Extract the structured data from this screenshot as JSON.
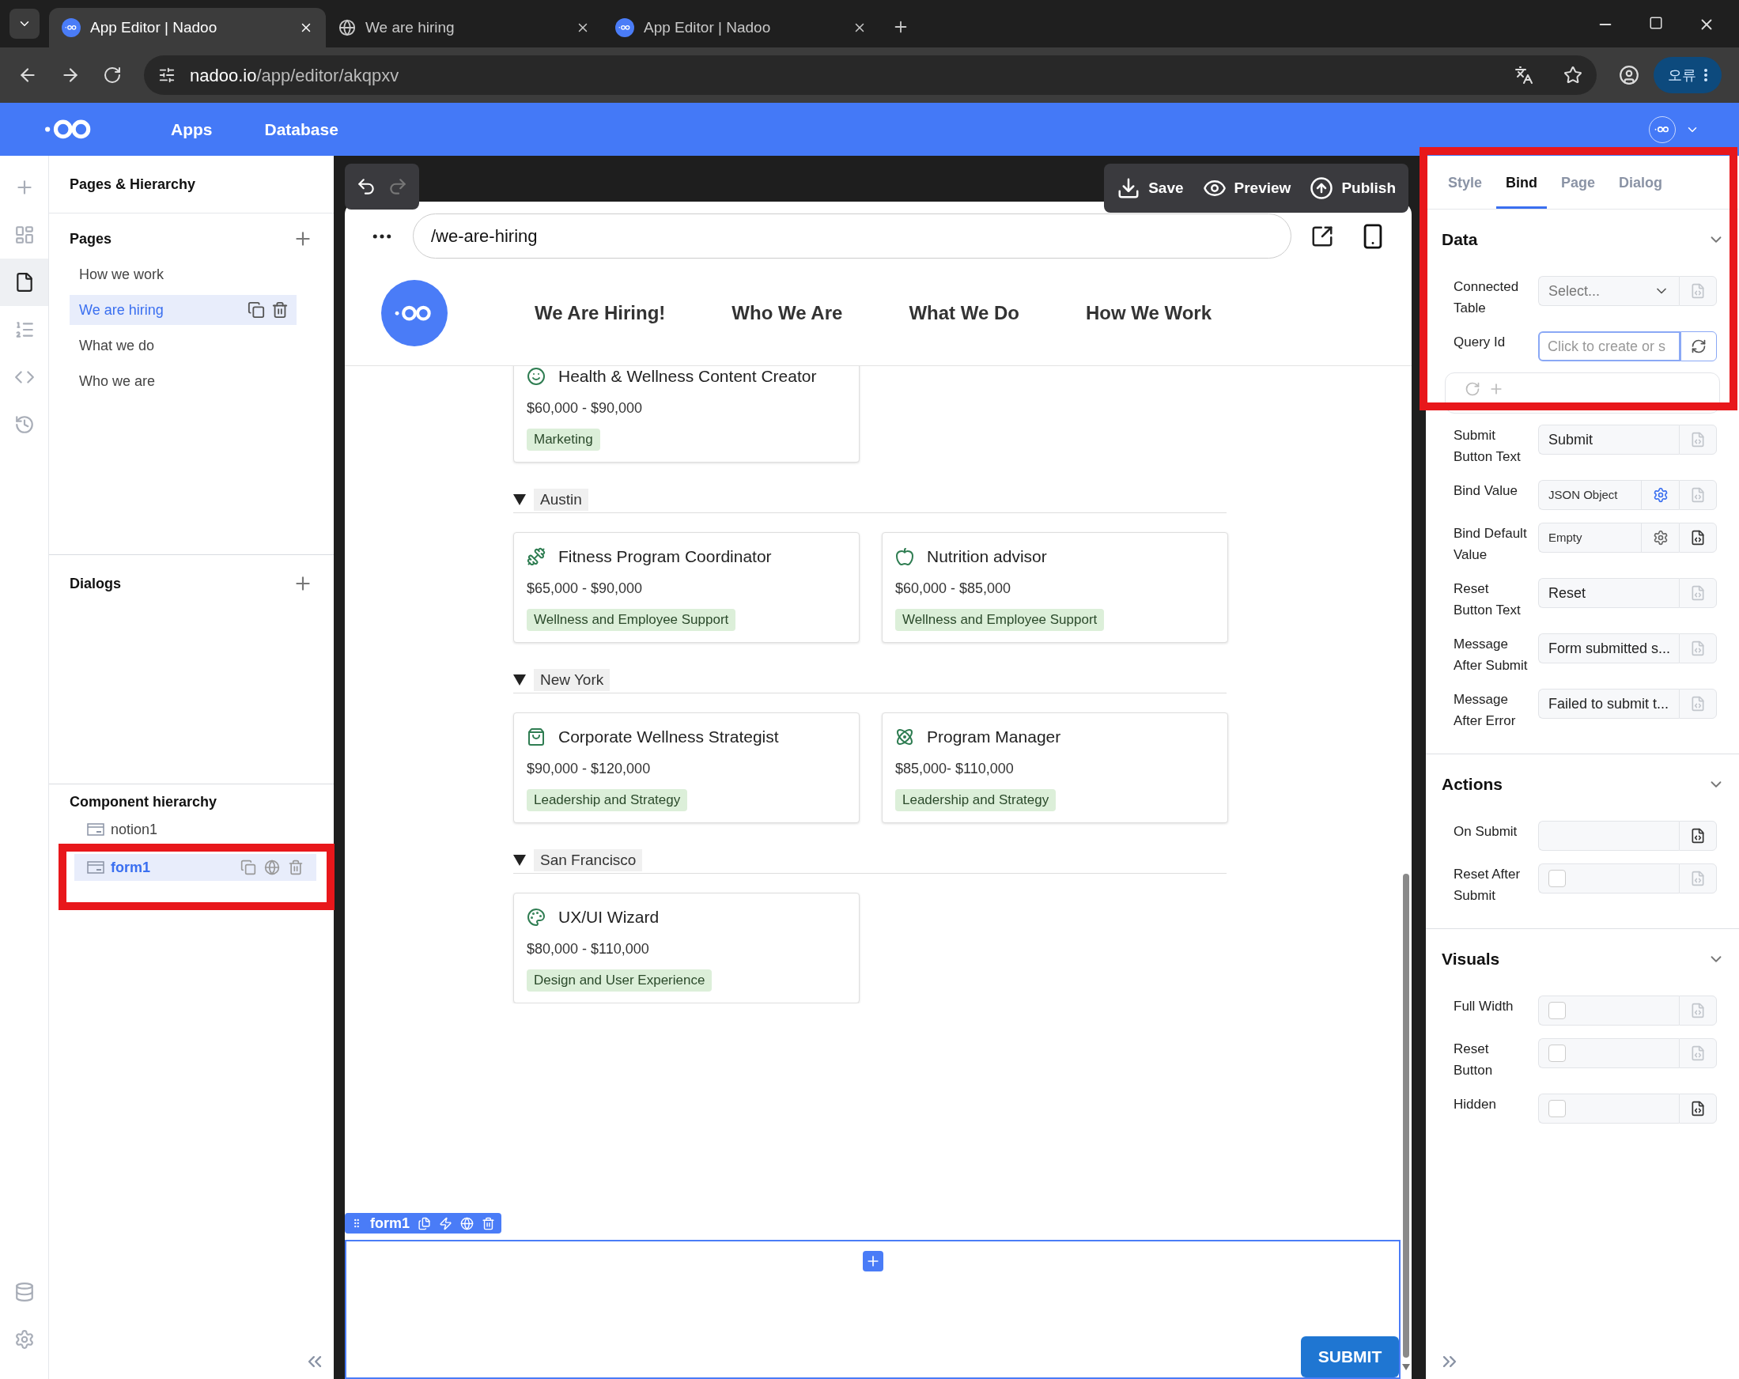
{
  "browser": {
    "tabs": [
      {
        "title": "App Editor | Nadoo",
        "kind": "app",
        "selected": true
      },
      {
        "title": "We are hiring",
        "kind": "web",
        "selected": false
      },
      {
        "title": "App Editor | Nadoo",
        "kind": "app",
        "selected": false
      }
    ],
    "url_host": "nadoo.io",
    "url_path": "/app/editor/akqpxv",
    "profile_label": "오류"
  },
  "app_header": {
    "nav": [
      "Apps",
      "Database"
    ]
  },
  "rail": {
    "items": [
      {
        "kind": "add",
        "selected": false
      },
      {
        "kind": "layout",
        "selected": false
      },
      {
        "kind": "pages",
        "selected": true
      },
      {
        "kind": "list",
        "selected": false
      },
      {
        "kind": "code",
        "selected": false
      },
      {
        "kind": "history",
        "selected": false
      }
    ],
    "bottom": [
      {
        "kind": "database"
      },
      {
        "kind": "settings"
      }
    ]
  },
  "left_panel": {
    "title": "Pages & Hierarchy",
    "pages_heading": "Pages",
    "pages": [
      {
        "label": "How we work",
        "selected": false
      },
      {
        "label": "We are hiring",
        "selected": true
      },
      {
        "label": "What we do",
        "selected": false
      },
      {
        "label": "Who we are",
        "selected": false
      }
    ],
    "dialogs_heading": "Dialogs",
    "hierarchy_heading": "Component hierarchy",
    "hierarchy": [
      {
        "label": "notion1",
        "selected": false
      },
      {
        "label": "form1",
        "selected": true
      }
    ]
  },
  "canvas": {
    "undo_disabled": false,
    "redo_disabled": true,
    "actions": [
      {
        "kind": "save",
        "label": "Save"
      },
      {
        "kind": "preview",
        "label": "Preview"
      },
      {
        "kind": "publish",
        "label": "Publish"
      }
    ],
    "path": "/we-are-hiring",
    "site_nav": [
      "We Are Hiring!",
      "Who We Are",
      "What We Do",
      "How We Work"
    ],
    "groups": [
      {
        "jobs": [
          {
            "kind": "smile",
            "title": "Health & Wellness Content Creator",
            "salary": "$60,000 - $90,000",
            "tag": "Marketing"
          }
        ]
      },
      {
        "location": "Austin",
        "expanded": true,
        "jobs": [
          {
            "kind": "dumbbell",
            "title": "Fitness Program Coordinator",
            "salary": "$65,000 - $90,000",
            "tag": "Wellness and Employee Support"
          },
          {
            "kind": "apple",
            "title": "Nutrition advisor",
            "salary": "$60,000 - $85,000",
            "tag": "Wellness and Employee Support"
          }
        ]
      },
      {
        "location": "New York",
        "expanded": true,
        "jobs": [
          {
            "kind": "bag",
            "title": "Corporate Wellness Strategist",
            "salary": "$90,000 - $120,000",
            "tag": "Leadership and Strategy"
          },
          {
            "kind": "atom",
            "title": "Program Manager",
            "salary": "$85,000- $110,000",
            "tag": "Leadership and Strategy"
          }
        ]
      },
      {
        "location": "San Francisco",
        "expanded": true,
        "jobs": [
          {
            "kind": "palette",
            "title": "UX/UI Wizard",
            "salary": "$80,000 - $110,000",
            "tag": "Design and User Experience"
          }
        ]
      }
    ],
    "form": {
      "label": "form1",
      "selected": true,
      "submit": "SUBMIT"
    }
  },
  "properties": {
    "tabs": [
      {
        "label": "Style",
        "selected": false
      },
      {
        "label": "Bind",
        "selected": true
      },
      {
        "label": "Page",
        "selected": false
      },
      {
        "label": "Dialog",
        "selected": false
      }
    ],
    "sections": [
      {
        "title": "Data",
        "expanded": true,
        "fields": [
          {
            "kind": "select",
            "label": "Connected Table",
            "placeholder": "Select...",
            "binding_active": false
          },
          {
            "kind": "query",
            "label": "Query Id",
            "placeholder": "Click to create or s",
            "focused": true
          },
          {
            "kind": "query_box"
          },
          {
            "kind": "text",
            "label": "Submit Button Text",
            "value": "Submit",
            "binding_active": false
          },
          {
            "kind": "json",
            "label": "Bind Value",
            "value": "JSON Object",
            "gear_active": true,
            "binding_active": false
          },
          {
            "kind": "json",
            "label": "Bind Default Value",
            "value": "Empty",
            "gear_active": false,
            "binding_active": true
          },
          {
            "kind": "text",
            "label": "Reset Button Text",
            "value": "Reset",
            "binding_active": false
          },
          {
            "kind": "text",
            "label": "Message After Submit",
            "value": "Form submitted s...",
            "binding_active": false
          },
          {
            "kind": "text",
            "label": "Message After Error",
            "value": "Failed to submit t...",
            "binding_active": false
          }
        ]
      },
      {
        "title": "Actions",
        "expanded": true,
        "fields": [
          {
            "kind": "text",
            "label": "On Submit",
            "binding_active": true
          },
          {
            "kind": "checkbox",
            "label": "Reset After Submit",
            "checked": false,
            "binding_active": false
          }
        ]
      },
      {
        "title": "Visuals",
        "expanded": true,
        "fields": [
          {
            "kind": "checkbox",
            "label": "Full Width",
            "checked": false,
            "binding_active": false
          },
          {
            "kind": "checkbox",
            "label": "Reset Button",
            "checked": false,
            "binding_active": false
          },
          {
            "kind": "checkbox",
            "label": "Hidden",
            "checked": false,
            "binding_active": true
          }
        ]
      }
    ]
  }
}
